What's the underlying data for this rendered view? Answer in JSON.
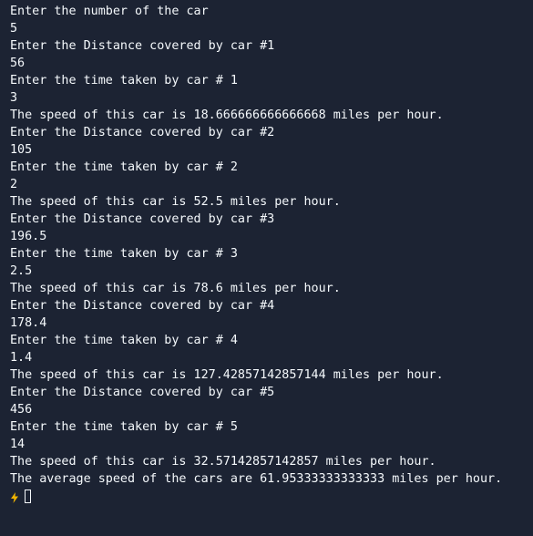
{
  "console": {
    "lines": [
      "Enter the number of the car",
      "5",
      "Enter the Distance covered by car #1",
      "56",
      "Enter the time taken by car # 1",
      "3",
      "The speed of this car is 18.666666666666668 miles per hour.",
      "Enter the Distance covered by car #2",
      "105",
      "Enter the time taken by car # 2",
      "2",
      "The speed of this car is 52.5 miles per hour.",
      "Enter the Distance covered by car #3",
      "196.5",
      "Enter the time taken by car # 3",
      "2.5",
      "The speed of this car is 78.6 miles per hour.",
      "Enter the Distance covered by car #4",
      "178.4",
      "Enter the time taken by car # 4",
      "1.4",
      "The speed of this car is 127.42857142857144 miles per hour.",
      "Enter the Distance covered by car #5",
      "456",
      "Enter the time taken by car # 5",
      "14",
      "The speed of this car is 32.57142857142857 miles per hour.",
      "The average speed of the cars are 61.95333333333333 miles per hour."
    ],
    "prompt_icon": "lightning-bolt-icon",
    "accent_color": "#f0b400"
  }
}
